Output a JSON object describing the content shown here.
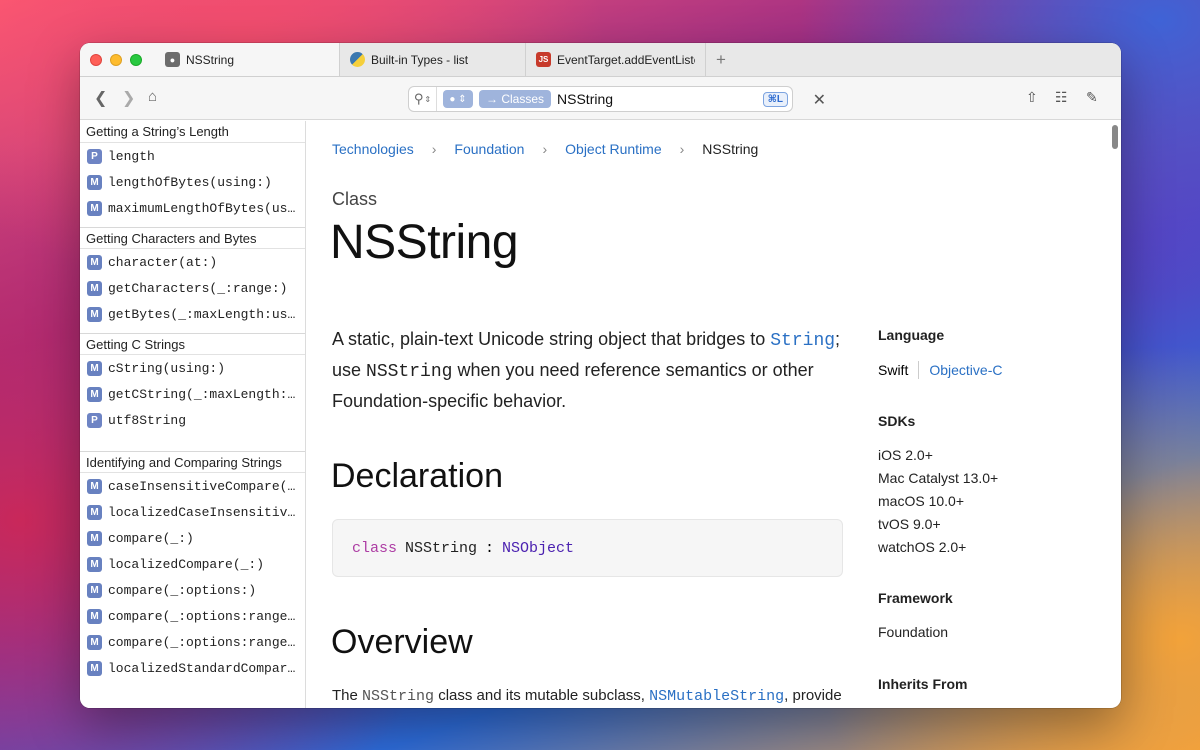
{
  "tabs": [
    {
      "title": "NSString",
      "favicon": "apple-icon",
      "active": true
    },
    {
      "title": "Built-in Types - list",
      "favicon": "python-icon"
    },
    {
      "title": "EventTarget.addEventListener",
      "favicon": "js-icon",
      "badge": "JS"
    }
  ],
  "toolbar": {
    "search_scope": "→ Classes",
    "search_value": "NSString",
    "shortcut": "⌘L"
  },
  "sidebar": {
    "sections": [
      {
        "title": "Getting a String’s Length",
        "items": [
          {
            "badge": "P",
            "label": "length"
          },
          {
            "badge": "M",
            "label": "lengthOfBytes(using:)"
          },
          {
            "badge": "M",
            "label": "maximumLengthOfBytes(using:)"
          }
        ]
      },
      {
        "title": "Getting Characters and Bytes",
        "items": [
          {
            "badge": "M",
            "label": "character(at:)"
          },
          {
            "badge": "M",
            "label": "getCharacters(_:range:)"
          },
          {
            "badge": "M",
            "label": "getBytes(_:maxLength:usedLength:encoding:options:range:remaining:)"
          }
        ]
      },
      {
        "title": "Getting C Strings",
        "items": [
          {
            "badge": "M",
            "label": "cString(using:)"
          },
          {
            "badge": "M",
            "label": "getCString(_:maxLength:encoding:)"
          },
          {
            "badge": "P",
            "label": "utf8String"
          }
        ]
      },
      {
        "title": "Identifying and Comparing Strings",
        "items": [
          {
            "badge": "M",
            "label": "caseInsensitiveCompare(_:)"
          },
          {
            "badge": "M",
            "label": "localizedCaseInsensitiveCompare(_:)"
          },
          {
            "badge": "M",
            "label": "compare(_:)"
          },
          {
            "badge": "M",
            "label": "localizedCompare(_:)"
          },
          {
            "badge": "M",
            "label": "compare(_:options:)"
          },
          {
            "badge": "M",
            "label": "compare(_:options:range:)"
          },
          {
            "badge": "M",
            "label": "compare(_:options:range:locale:)"
          },
          {
            "badge": "M",
            "label": "localizedStandardCompare(_:)"
          }
        ]
      }
    ]
  },
  "breadcrumbs": [
    "Technologies",
    "Foundation",
    "Object Runtime",
    "NSString"
  ],
  "doc": {
    "kind": "Class",
    "title": "NSString",
    "abstract_part1": "A static, plain-text Unicode string object that bridges to ",
    "abstract_link": "String",
    "abstract_part2": "; use ",
    "abstract_code": "NSString",
    "abstract_part3": " when you need reference semantics or other Foundation-specific behavior.",
    "declaration_heading": "Declaration",
    "declaration": {
      "keyword": "class",
      "type": "NSString",
      "colon": ":",
      "super": "NSObject"
    },
    "overview_heading": "Overview",
    "overview_part1": "The ",
    "overview_code": "NSString",
    "overview_part2": " class and its mutable subclass, ",
    "overview_link": "NSMutableString",
    "overview_part3": ", provide"
  },
  "aside": {
    "language_heading": "Language",
    "languages": [
      "Swift",
      "Objective-C"
    ],
    "sdks_heading": "SDKs",
    "sdks": [
      "iOS 2.0+",
      "Mac Catalyst 13.0+",
      "macOS 10.0+",
      "tvOS 9.0+",
      "watchOS 2.0+"
    ],
    "framework_heading": "Framework",
    "framework": "Foundation",
    "inherits_heading": "Inherits From"
  }
}
